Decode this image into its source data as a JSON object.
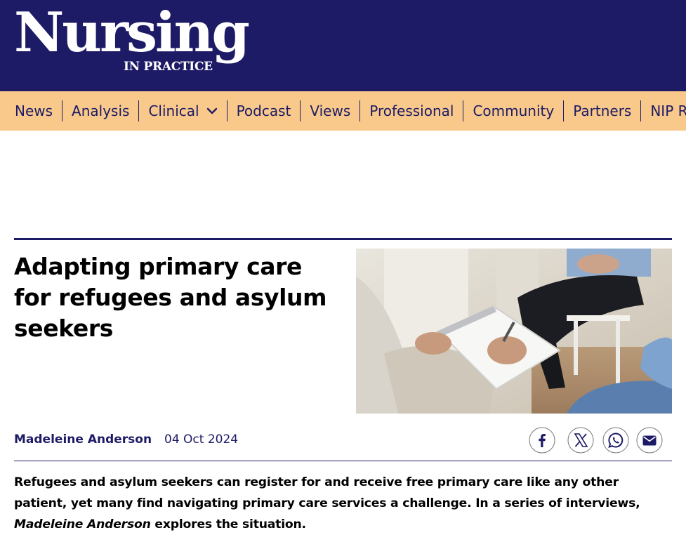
{
  "brand": {
    "name": "Nursing",
    "tagline": "IN PRACTICE",
    "background_color": "#1d1b66"
  },
  "nav": {
    "background_color": "#f8c98a",
    "items": [
      {
        "label": "News"
      },
      {
        "label": "Analysis"
      },
      {
        "label": "Clinical",
        "has_dropdown": true,
        "icon": "chevron-down-icon"
      },
      {
        "label": "Podcast"
      },
      {
        "label": "Views"
      },
      {
        "label": "Professional"
      },
      {
        "label": "Community"
      },
      {
        "label": "Partners"
      },
      {
        "label": "NIP Re"
      }
    ]
  },
  "article": {
    "title": "Adapting primary care for refugees and asylum seekers",
    "author": "Madeleine Anderson",
    "date": "04 Oct 2024",
    "standfirst_before": "Refugees and asylum seekers can register for and receive free primary care like any other patient, yet many find navigating primary care services a challenge. In a series of interviews, ",
    "standfirst_author": "Madeleine Anderson",
    "standfirst_after": " explores the situation.",
    "image_icon": "consultation-photo"
  },
  "share": [
    {
      "icon": "facebook-icon"
    },
    {
      "icon": "x-icon"
    },
    {
      "icon": "whatsapp-icon"
    },
    {
      "icon": "email-icon"
    }
  ]
}
